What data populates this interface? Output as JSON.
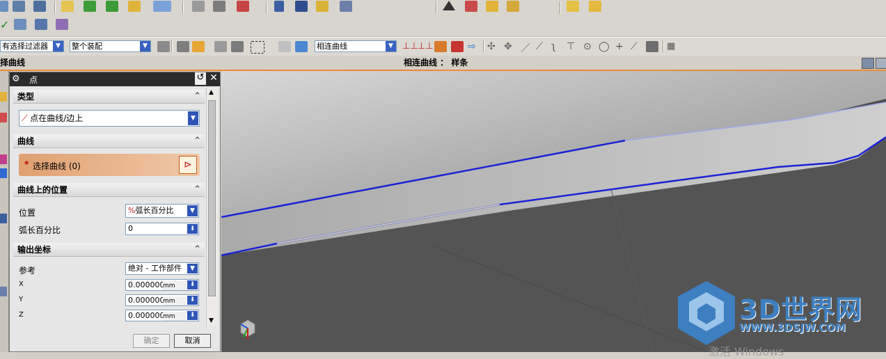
{
  "toolbar_top": {
    "icons": [
      "layers-icon",
      "part-icon",
      "note-icon",
      "check-icon",
      "check-multi-icon",
      "check-folder-icon",
      "abc-icon",
      "sketch-icon",
      "pen-icon",
      "shape-icon",
      "doc-icon",
      "brush-icon",
      "magnet-icon",
      "wrench-icon",
      "triangle-icon",
      "triangle-grid-icon",
      "move-icon",
      "component-icon",
      "box-icon",
      "boxes-icon"
    ]
  },
  "selection_bar": {
    "filter_value": "有选择过滤器",
    "scope_value": "整个装配",
    "curve_rule_value": "相连曲线"
  },
  "cue_line": {
    "left_text": "择曲线",
    "center_text": "相连曲线 ： 样条"
  },
  "dialog": {
    "title": "点",
    "type_section": {
      "label": "类型",
      "value": "点在曲线/边上"
    },
    "curve_section": {
      "label": "曲线",
      "select_label": "选择曲线 (0)",
      "required_mark": "*"
    },
    "position_section": {
      "label": "曲线上的位置",
      "position_label": "位置",
      "position_value": "弧长百分比",
      "percent_label": "弧长百分比",
      "percent_value": "0"
    },
    "output_section": {
      "label": "输出坐标",
      "ref_label": "参考",
      "ref_value": "绝对 - 工作部件",
      "x_label": "X",
      "x_value": "0.0000000",
      "x_unit": "mm",
      "y_label": "Y",
      "y_value": "0.0000000",
      "y_unit": "mm",
      "z_label": "Z",
      "z_value": "0.0000000",
      "z_unit": "mm"
    },
    "ok_label": "确定",
    "cancel_label": "取消"
  },
  "watermark": {
    "brand": "3D世界网",
    "url": "WWW.3DSJW.COM",
    "activate_text": "激活 Windows"
  },
  "colors": {
    "highlight_curve": "#1a22d6",
    "accent_orange": "#e88b35",
    "selection_row": "#e4a879",
    "brand_blue": "#3d7fc0"
  }
}
